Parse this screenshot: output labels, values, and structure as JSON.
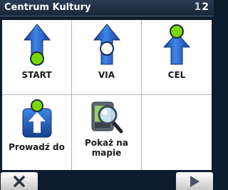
{
  "header": {
    "title": "Centrum Kultury",
    "page_current": "1",
    "page_next": "2"
  },
  "menu": [
    {
      "label": "START",
      "icon": "start-arrow-icon"
    },
    {
      "label": "VIA",
      "icon": "via-arrow-icon"
    },
    {
      "label": "CEL",
      "icon": "cel-arrow-icon"
    },
    {
      "label": "Prowadź do",
      "icon": "navigate-to-icon"
    },
    {
      "label_line1": "Pokaż na",
      "label_line2": "mapie",
      "icon": "magnifier-map-icon"
    }
  ],
  "footer": {
    "close_icon": "close-icon",
    "next_icon": "play-next-icon"
  },
  "colors": {
    "accent_blue": "#2f6fd0",
    "marker_green": "#7ad800",
    "background": "#0d1c2c"
  }
}
